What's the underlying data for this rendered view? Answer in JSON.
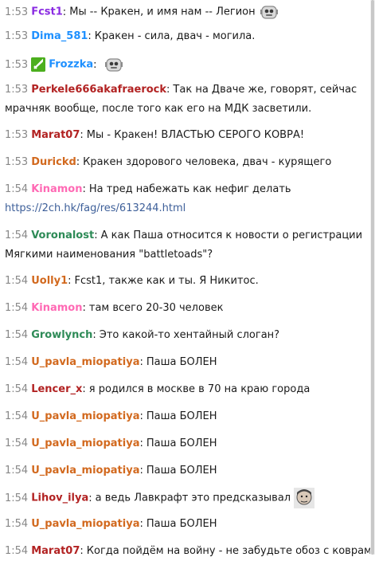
{
  "colors": {
    "purple": "#8a2be2",
    "blue": "#1e90ff",
    "red": "#b22222",
    "orange": "#d2691e",
    "pink": "#ff69b4",
    "green": "#2e8b57",
    "time": "#888888"
  },
  "messages": [
    {
      "time": "1:53",
      "user": "Fcst1",
      "color": "#8a2be2",
      "text": "Мы -- Кракен, и имя нам -- Легион",
      "emote": "robot-emote-icon"
    },
    {
      "time": "1:53",
      "user": "Dima_581",
      "color": "#1e90ff",
      "text": "Кракен - сила, двач - могила."
    },
    {
      "time": "1:53",
      "user": "Frozzka",
      "color": "#1e90ff",
      "text": "",
      "badge": "sword-badge-icon",
      "emote": "robot-emote-icon"
    },
    {
      "time": "1:53",
      "user": "Perkele666akafraerock",
      "color": "#b22222",
      "text": "Так на Дваче же, говорят, сейчас мрачняк вообще, после того как его на МДК засветили."
    },
    {
      "time": "1:53",
      "user": "Marat07",
      "color": "#b22222",
      "text": "Мы - Кракен! ВЛАСТЬЮ СЕРОГО КОВРА!"
    },
    {
      "time": "1:53",
      "user": "Durickd",
      "color": "#d2691e",
      "text": "Кракен здорового человека, двач - курящего"
    },
    {
      "time": "1:54",
      "user": "Kinamon",
      "color": "#ff69b4",
      "text": "На тред набежать как нефиг делать ",
      "link": "https://2ch.hk/fag/res/613244.html"
    },
    {
      "time": "1:54",
      "user": "Voronalost",
      "color": "#2e8b57",
      "text": "А как Паша относится к новости о регистрации Мягкими наименования \"battletoads\"?"
    },
    {
      "time": "1:54",
      "user": "Uolly1",
      "color": "#d2691e",
      "text": "Fcst1, также как и ты. Я Никитос."
    },
    {
      "time": "1:54",
      "user": "Kinamon",
      "color": "#ff69b4",
      "text": "там всего 20-30 человек"
    },
    {
      "time": "1:54",
      "user": "Growlynch",
      "color": "#2e8b57",
      "text": "Это какой-то хентайный слоган?"
    },
    {
      "time": "1:54",
      "user": "U_pavla_miopatiya",
      "color": "#d2691e",
      "text": "Паша БОЛЕН"
    },
    {
      "time": "1:54",
      "user": "Lencer_x",
      "color": "#b22222",
      "text": "я родился в москве в 70 на краю города"
    },
    {
      "time": "1:54",
      "user": "U_pavla_miopatiya",
      "color": "#d2691e",
      "text": "Паша БОЛЕН"
    },
    {
      "time": "1:54",
      "user": "U_pavla_miopatiya",
      "color": "#d2691e",
      "text": "Паша БОЛЕН"
    },
    {
      "time": "1:54",
      "user": "U_pavla_miopatiya",
      "color": "#d2691e",
      "text": "Паша БОЛЕН"
    },
    {
      "time": "1:54",
      "user": "Lihov_ilya",
      "color": "#b22222",
      "text": "а ведь Лавкрафт это предсказывал",
      "emote": "face-emote-icon"
    },
    {
      "time": "1:54",
      "user": "U_pavla_miopatiya",
      "color": "#d2691e",
      "text": "Паша БОЛЕН"
    },
    {
      "time": "1:54",
      "user": "Marat07",
      "color": "#b22222",
      "text": "Когда пойдём на войну - не забудьте обоз с коврами!"
    }
  ]
}
